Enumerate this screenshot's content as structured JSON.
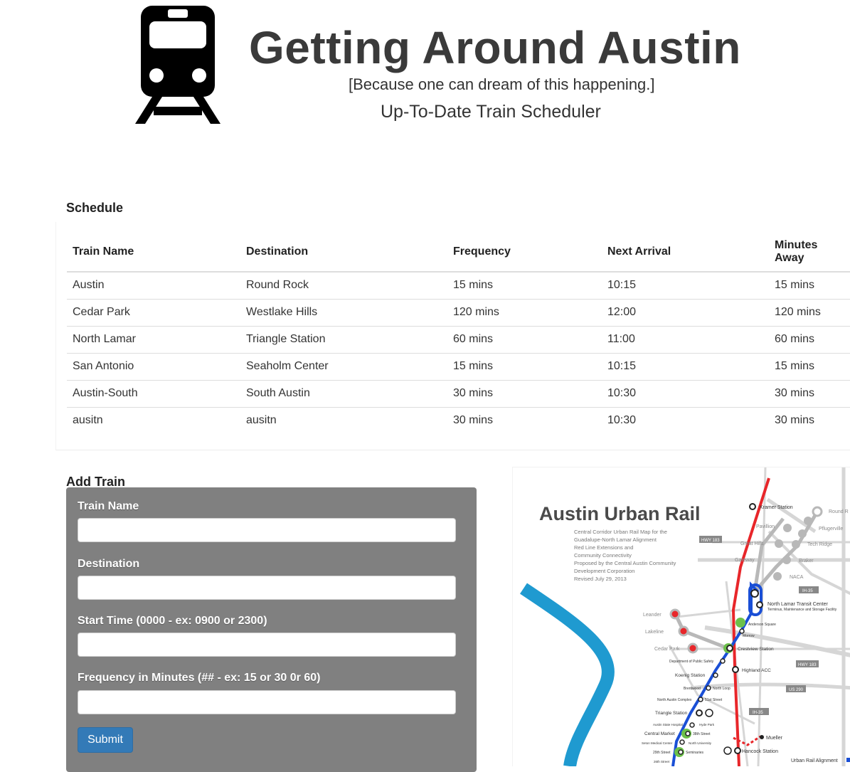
{
  "header": {
    "title": "Getting Around Austin",
    "tagline": "[Because one can dream of this happening.]",
    "subtitle": "Up-To-Date Train Scheduler",
    "icon": "train-icon"
  },
  "schedule": {
    "heading": "Schedule",
    "columns": [
      "Train Name",
      "Destination",
      "Frequency",
      "Next Arrival",
      "Minutes Away"
    ],
    "rows": [
      [
        "Austin",
        "Round Rock",
        "15 mins",
        "10:15",
        "15 mins"
      ],
      [
        "Cedar Park",
        "Westlake Hills",
        "120 mins",
        "12:00",
        "120 mins"
      ],
      [
        "North Lamar",
        "Triangle Station",
        "60 mins",
        "11:00",
        "60 mins"
      ],
      [
        "San Antonio",
        "Seaholm Center",
        "15 mins",
        "10:15",
        "15 mins"
      ],
      [
        "Austin-South",
        "South Austin",
        "30 mins",
        "10:30",
        "30 mins"
      ],
      [
        "ausitn",
        "ausitn",
        "30 mins",
        "10:30",
        "30 mins"
      ]
    ]
  },
  "add_train": {
    "heading": "Add Train",
    "fields": [
      {
        "label": "Train Name",
        "value": "",
        "placeholder": ""
      },
      {
        "label": "Destination",
        "value": "",
        "placeholder": ""
      },
      {
        "label": "Start Time (0000 - ex: 0900 or 2300)",
        "value": "",
        "placeholder": ""
      },
      {
        "label": "Frequency in Minutes (## - ex: 15 or 30 0r 60)",
        "value": "",
        "placeholder": ""
      }
    ],
    "submit_label": "Submit"
  },
  "map": {
    "title": "Austin Urban Rail",
    "description_lines": [
      "Central Corridor Urban Rail Map for the",
      "Guadalupe-North Lamar Alignment",
      "Red Line Extensions and",
      "Community Connectivity",
      "Proposed by the Central Austin Community",
      "Development Corporation",
      "Revised July 29, 2013"
    ],
    "stations": {
      "kramer": "Kramer Station",
      "round": "Round R",
      "pavillion": "Pavillion",
      "pflugerville": "Pflugerville",
      "great_hills": "Great Hills",
      "tech_ridge": "Tech Ridge",
      "gateway": "Gateway",
      "braker": "Braker",
      "naca": "NACA",
      "north_lamar_tc": "North Lamar Transit Center",
      "north_lamar_tc_sub": "Terminus, Maintenance and Storage Facility",
      "leander": "Leander",
      "lakeline": "Lakeline",
      "cedar_park": "Cedar Park",
      "anderson_square": "Anderson Square",
      "morrow": "Morrow",
      "crestview": "Crestview Station",
      "dept_public_safety": "Department of Public Safety",
      "highland_acc": "Highland ACC",
      "koenig": "Koenig Station",
      "brentwood": "Brentwood",
      "north_loop": "North Loop",
      "north_austin_complex": "North Austin Complex",
      "st51": "51st Street",
      "triangle": "Triangle Station",
      "austin_state_hospital": "Austin State Hospital",
      "hyde_park": "Hyde Park",
      "central_market": "Central Market",
      "st38": "38th Street",
      "seton": "Seton Medical Center",
      "north_university": "North University",
      "st29": "29th Street",
      "seminaries": "Seminaries",
      "st26": "26th Street",
      "mueller": "Mueller",
      "hancock": "Hancock Station"
    },
    "road_signs": {
      "hwy183_top": "HWY 183",
      "ih35_top": "IH-35",
      "hwy183_mid": "HWY 183",
      "us290": "US 290",
      "ih35_bottom": "IH-35"
    },
    "legend": "Urban Rail Alignment",
    "colors": {
      "red_line": "#e8262a",
      "blue_line": "#1a4fd6",
      "river": "#1f9ad0",
      "green_station": "#6cc04a",
      "roads": "#d6d6d6"
    }
  }
}
